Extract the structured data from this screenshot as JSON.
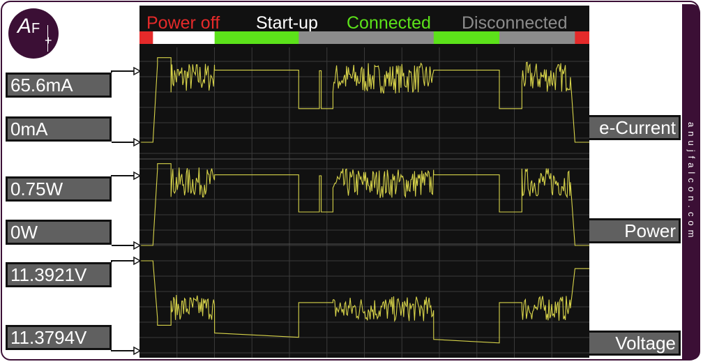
{
  "watermark": "anujfalcon.com",
  "logo": {
    "mark_big": "A",
    "mark_small": "F",
    "plus": "+"
  },
  "colors": {
    "plot_bg": "#111111",
    "grid": "#3a3a3a",
    "trace": "#d8d44a",
    "phase_power_off": "#e52a2a",
    "phase_startup": "#ffffff",
    "phase_connected": "#5ce21a",
    "phase_disconnected": "#8c8c8c",
    "brand": "#3b0f35"
  },
  "phases": [
    {
      "label": "Power off",
      "color": "#e52a2a"
    },
    {
      "label": "Start-up",
      "color": "#ffffff"
    },
    {
      "label": "Connected",
      "color": "#5ce21a"
    },
    {
      "label": "Disconnected",
      "color": "#8c8c8c"
    }
  ],
  "timeline": [
    {
      "phase": "Power off",
      "start": 0,
      "end": 0.03
    },
    {
      "phase": "Start-up",
      "start": 0.03,
      "end": 0.167
    },
    {
      "phase": "Connected",
      "start": 0.167,
      "end": 0.354
    },
    {
      "phase": "Disconnected",
      "start": 0.354,
      "end": 0.654
    },
    {
      "phase": "Connected",
      "start": 0.654,
      "end": 0.8
    },
    {
      "phase": "Disconnected",
      "start": 0.8,
      "end": 0.968
    },
    {
      "phase": "Power off",
      "start": 0.968,
      "end": 1.0
    }
  ],
  "chart_data": [
    {
      "type": "line",
      "title": "e-Current",
      "ylabel": "",
      "ylim": [
        0,
        65.6
      ],
      "tick_labels": {
        "top": "65.6mA",
        "bottom": "0mA"
      },
      "pattern": "current_power",
      "segments": [
        {
          "start": 0,
          "end": 0.03,
          "kind": "flat",
          "level": 0
        },
        {
          "start": 0.03,
          "end": 0.04,
          "kind": "ramp",
          "from": 0,
          "to": 72
        },
        {
          "start": 0.04,
          "end": 0.07,
          "kind": "flat",
          "level": 78
        },
        {
          "start": 0.07,
          "end": 0.167,
          "kind": "noise",
          "level": 60,
          "amp": 14
        },
        {
          "start": 0.167,
          "end": 0.354,
          "kind": "flat",
          "level": 66.5
        },
        {
          "start": 0.354,
          "end": 0.4,
          "kind": "flat",
          "level": 31
        },
        {
          "start": 0.4,
          "end": 0.404,
          "kind": "spike",
          "level": 66
        },
        {
          "start": 0.404,
          "end": 0.43,
          "kind": "flat",
          "level": 31
        },
        {
          "start": 0.43,
          "end": 0.654,
          "kind": "noise",
          "level": 59,
          "amp": 14
        },
        {
          "start": 0.654,
          "end": 0.8,
          "kind": "flat",
          "level": 66.5
        },
        {
          "start": 0.8,
          "end": 0.85,
          "kind": "flat",
          "level": 31
        },
        {
          "start": 0.85,
          "end": 0.958,
          "kind": "noise",
          "level": 60,
          "amp": 14
        },
        {
          "start": 0.958,
          "end": 0.968,
          "kind": "ramp",
          "from": 60,
          "to": 0
        },
        {
          "start": 0.968,
          "end": 1.0,
          "kind": "flat",
          "level": 0
        }
      ]
    },
    {
      "type": "line",
      "title": "Power",
      "ylabel": "",
      "ylim": [
        0,
        0.75
      ],
      "tick_labels": {
        "top": "0.75W",
        "bottom": "0W"
      },
      "pattern": "current_power",
      "segments": [
        {
          "start": 0,
          "end": 0.03,
          "kind": "flat",
          "level": 0
        },
        {
          "start": 0.03,
          "end": 0.04,
          "kind": "ramp",
          "from": 0,
          "to": 0.82
        },
        {
          "start": 0.04,
          "end": 0.07,
          "kind": "flat",
          "level": 0.88
        },
        {
          "start": 0.07,
          "end": 0.167,
          "kind": "noise",
          "level": 0.68,
          "amp": 0.16
        },
        {
          "start": 0.167,
          "end": 0.354,
          "kind": "flat",
          "level": 0.76
        },
        {
          "start": 0.354,
          "end": 0.4,
          "kind": "flat",
          "level": 0.36
        },
        {
          "start": 0.4,
          "end": 0.404,
          "kind": "spike",
          "level": 0.75
        },
        {
          "start": 0.404,
          "end": 0.43,
          "kind": "flat",
          "level": 0.36
        },
        {
          "start": 0.43,
          "end": 0.654,
          "kind": "noise",
          "level": 0.67,
          "amp": 0.16
        },
        {
          "start": 0.654,
          "end": 0.8,
          "kind": "flat",
          "level": 0.76
        },
        {
          "start": 0.8,
          "end": 0.85,
          "kind": "flat",
          "level": 0.36
        },
        {
          "start": 0.85,
          "end": 0.958,
          "kind": "noise",
          "level": 0.68,
          "amp": 0.16
        },
        {
          "start": 0.958,
          "end": 0.968,
          "kind": "ramp",
          "from": 0.68,
          "to": 0
        },
        {
          "start": 0.968,
          "end": 1.0,
          "kind": "flat",
          "level": 0
        }
      ]
    },
    {
      "type": "line",
      "title": "Voltage",
      "ylabel": "",
      "ylim": [
        11.3794,
        11.3921
      ],
      "tick_labels": {
        "top": "11.3921V",
        "bottom": "11.3794V"
      },
      "pattern": "voltage",
      "segments": [
        {
          "start": 0,
          "end": 0.03,
          "kind": "flat",
          "level": 11.3921
        },
        {
          "start": 0.03,
          "end": 0.04,
          "kind": "ramp",
          "from": 11.3921,
          "to": 11.384
        },
        {
          "start": 0.04,
          "end": 0.07,
          "kind": "flat",
          "level": 11.383
        },
        {
          "start": 0.07,
          "end": 0.167,
          "kind": "noise",
          "level": 11.3855,
          "amp": 0.0018
        },
        {
          "start": 0.167,
          "end": 0.354,
          "kind": "slope",
          "from": 11.3819,
          "to": 11.3813
        },
        {
          "start": 0.354,
          "end": 0.43,
          "kind": "flat",
          "level": 11.3862
        },
        {
          "start": 0.43,
          "end": 0.654,
          "kind": "noise",
          "level": 11.3853,
          "amp": 0.0018
        },
        {
          "start": 0.654,
          "end": 0.8,
          "kind": "slope",
          "from": 11.381,
          "to": 11.3805
        },
        {
          "start": 0.8,
          "end": 0.85,
          "kind": "flat",
          "level": 11.3862
        },
        {
          "start": 0.85,
          "end": 0.958,
          "kind": "noise",
          "level": 11.3854,
          "amp": 0.0018
        },
        {
          "start": 0.958,
          "end": 0.968,
          "kind": "ramp",
          "from": 11.3854,
          "to": 11.391
        },
        {
          "start": 0.968,
          "end": 1.0,
          "kind": "flat",
          "level": 11.391
        }
      ]
    }
  ]
}
